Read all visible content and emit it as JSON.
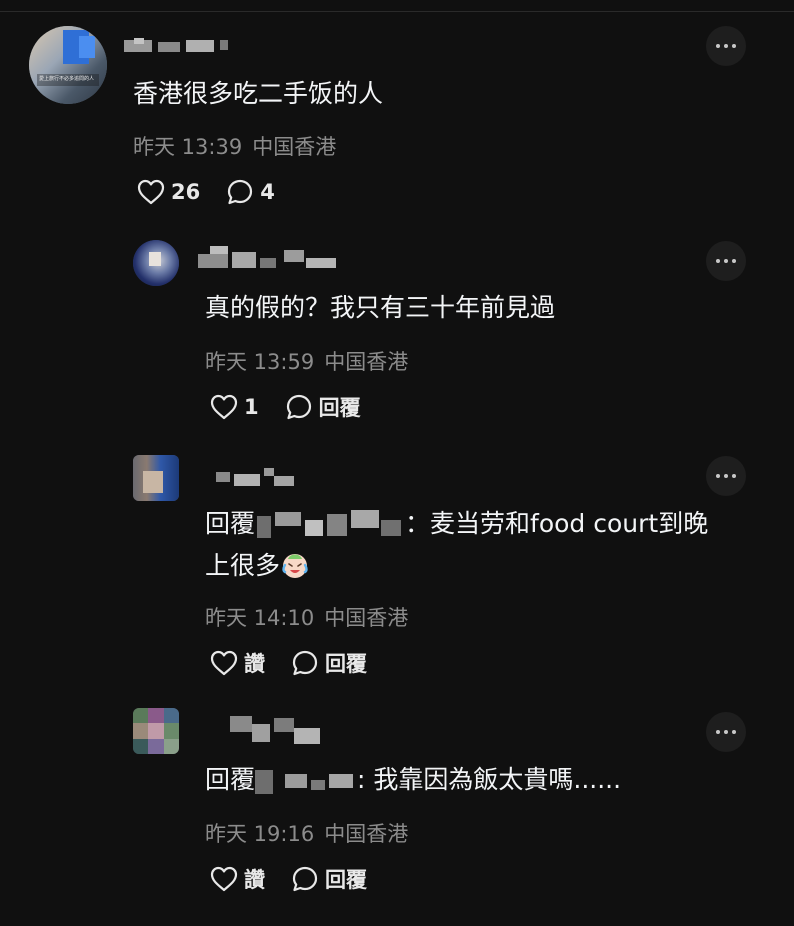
{
  "comments": [
    {
      "text": "香港很多吃二手饭的人",
      "time": "昨天 13:39",
      "location": "中国香港",
      "like_count": "26",
      "reply_count": "4",
      "avatar_caption": "愛上旅行不必多追問的人"
    },
    {
      "text": "真的假的？我只有三十年前見過",
      "time": "昨天 13:59",
      "location": "中国香港",
      "like_count": "1",
      "reply_label": "回覆"
    },
    {
      "reply_prefix": "回覆",
      "text_after": "：麦当劳和food court到晚",
      "text_line2": "上很多",
      "time": "昨天 14:10",
      "location": "中国香港",
      "like_label": "讚",
      "reply_label": "回覆"
    },
    {
      "reply_prefix": "回覆",
      "text_after": ": 我靠因為飯太貴嗎......",
      "time": "昨天 19:16",
      "location": "中国香港",
      "like_label": "讚",
      "reply_label": "回覆"
    }
  ],
  "icons": {
    "more": "more-options-icon",
    "like": "heart-icon",
    "reply": "speech-bubble-icon",
    "emoji": "crying-laughing-face-emoji"
  },
  "colors": {
    "background": "#101010",
    "text": "#f3f5f7",
    "meta": "#8c8c8c",
    "button_bg": "#1e1e1e"
  }
}
